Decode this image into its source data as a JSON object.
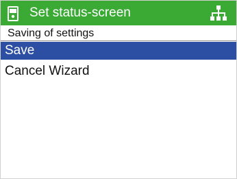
{
  "header": {
    "title": "Set status-screen",
    "left_icon": "device-icon",
    "right_icon": "network-icon",
    "background_color": "#3aaa35"
  },
  "subtitle": "Saving of settings",
  "menu": {
    "selected_index": 0,
    "selected_color": "#2d4fa3",
    "items": [
      {
        "label": "Save"
      },
      {
        "label": "Cancel Wizard"
      }
    ]
  }
}
